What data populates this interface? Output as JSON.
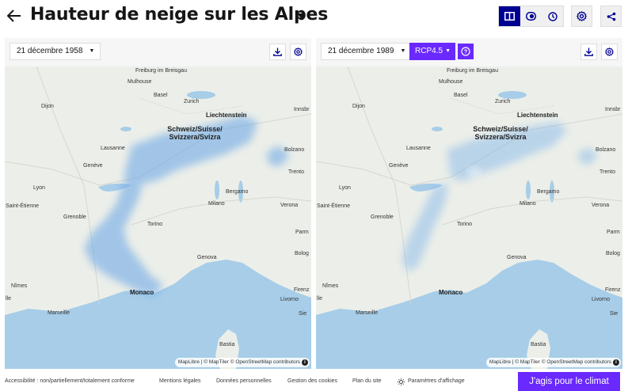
{
  "header": {
    "title": "Hauteur de neige sur les Alpes",
    "back_icon": "arrow-left-icon",
    "view_modes": [
      "split-view-icon",
      "compare-toggle-icon",
      "history-clock-icon"
    ],
    "settings_icon": "gear-icon",
    "share_icon": "share-icon",
    "accent_color": "#000091"
  },
  "panels": {
    "left": {
      "date": "21 décembre 1958",
      "attribution": "MapLibre | © MapTiler © OpenStreetMap contributors"
    },
    "right": {
      "date": "21 décembre 1989",
      "scenario": "RCP4.5",
      "attribution": "MapLibre | © MapTiler © OpenStreetMap contributors"
    }
  },
  "map_labels": {
    "freiburg": "Freiburg im Breisgau",
    "mulhouse": "Mulhouse",
    "basel": "Basel",
    "zurich": "Zurich",
    "liechtenstein": "Liechtenstein",
    "innsbruck": "Innsbr",
    "dijon": "Dijon",
    "schweiz": "Schweiz/Suisse/",
    "svizzera": "Svizzera/Svizra",
    "lausanne": "Lausanne",
    "bolzano": "Bolzano",
    "geneve": "Genève",
    "trento": "Trento",
    "lyon": "Lyon",
    "bergamo": "Bergamo",
    "saint_etienne": "Saint-Étienne",
    "milano": "Milano",
    "verona": "Verona",
    "grenoble": "Grenoble",
    "torino": "Torino",
    "parma": "Parm",
    "bologna": "Bolog",
    "genova": "Genova",
    "nimes": "Nîmes",
    "monaco": "Monaco",
    "firenze": "Firenz",
    "marseille": "Marseille",
    "livorno": "Livorno",
    "siena": "Sie",
    "bastia": "Bastia",
    "avignon": "lle"
  },
  "footer": {
    "links": [
      "Accessibilité : non/partiellement/totalement conforme",
      "Mentions légales",
      "Données personnelles",
      "Gestion des cookies",
      "Plan du site",
      "Paramètres d'affichage"
    ],
    "display_icon": "display-settings-icon",
    "cta": "J'agis pour le climat",
    "cta_color": "#6a29ff"
  }
}
